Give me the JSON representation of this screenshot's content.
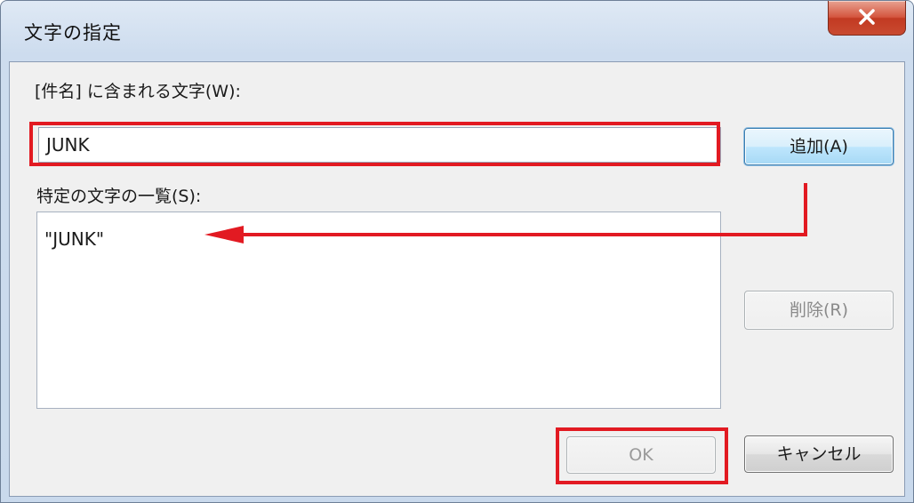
{
  "dialog": {
    "title": "文字の指定"
  },
  "input_section": {
    "label": "[件名] に含まれる文字(W):",
    "value": "JUNK"
  },
  "list_section": {
    "label": "特定の文字の一覧(S):",
    "items": [
      "\"JUNK\""
    ]
  },
  "buttons": {
    "add": "追加(A)",
    "delete": "削除(R)",
    "ok": "OK",
    "cancel": "キャンセル"
  },
  "icons": {
    "close": "close-icon"
  },
  "colors": {
    "highlight_red": "#e21a22",
    "add_button_blue": "#bee6fd",
    "close_button_red": "#c94a30"
  }
}
